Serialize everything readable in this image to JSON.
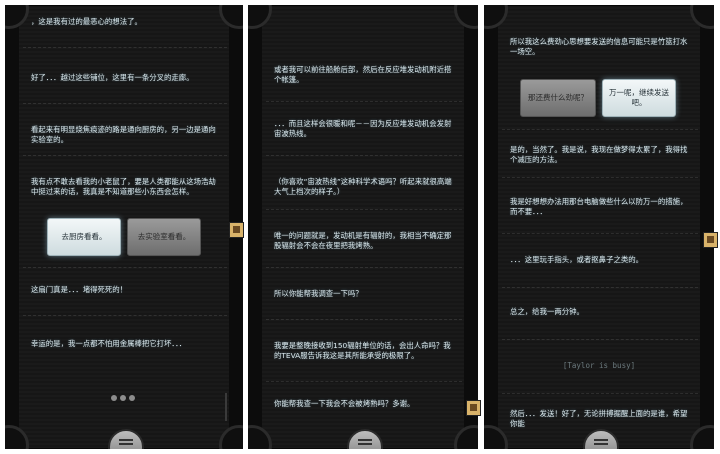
{
  "panel1": {
    "messages": [
      "，这是我有过的最恶心的想法了。",
      "好了．．．越过这些铺位，这里有一条分叉的走廊。",
      "看起来有明显烧焦痕迹的路是通向厨房的，另一边是通向实验室的。",
      "我有点不敢去看我的小老鼠了，要是人类都能从这场浩劫中挺过来的话，我真是不知道那些小东西会怎样。",
      "这扇门真是．．．堵得死死的！",
      "幸运的是，我一点都不怕用金属棒把它打坏．．．"
    ],
    "choice_left": "去厨房看看。",
    "choice_right": "去实验室看看。"
  },
  "panel2": {
    "messages": [
      "或者我可以前往船舱后部，然后在反应堆发动机附近搭个帐篷。",
      "．．．而且这样会很暖和呢－－因为反应堆发动机会发射宙波热线。",
      "（你喜欢“宙波热线”这种科学术语吗？听起来就很高端大气上档次的样子。）",
      "唯一的问题就是，发动机是有辐射的，我相当不确定那股辐射会不会在夜里把我烤熟。",
      "所以你能帮我调查一下吗？",
      "我要是整晚接收到150辐射单位的话，会出人命吗？我的TEVA服告诉我这是其所能承受的极限了。",
      "你能帮我查一下我会不会被烤熟吗？多谢。"
    ]
  },
  "panel3": {
    "messages": [
      "所以我这么费劲心思想要发送的信息可能只是竹篮打水一场空。",
      "是的，当然了。我是说，我现在做梦得太累了，我得找个减压的方法。",
      "我是好想想办法用那台电脑做些什么以防万一的措施，而不要．．．",
      "．．．这里玩手指头，或者抠鼻子之类的。",
      "总之，给我一两分钟。",
      "然后．．．发送！好了，无论拼搏掘醒上面的是谁，希望你能"
    ],
    "choice_left": "那还费什么劲呢？",
    "choice_right": "万一呢，继续发送吧。",
    "status": "[Taylor is busy]"
  }
}
